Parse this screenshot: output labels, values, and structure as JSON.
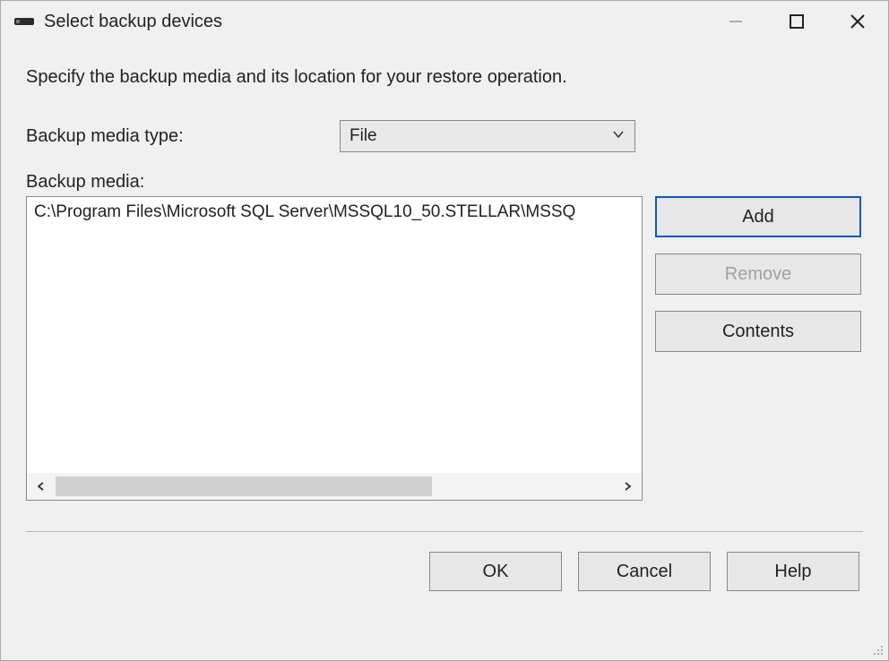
{
  "window": {
    "title": "Select backup devices"
  },
  "instruction": "Specify the backup media and its location for your restore operation.",
  "mediaType": {
    "label": "Backup media type:",
    "selected": "File"
  },
  "mediaList": {
    "label": "Backup media:",
    "items": [
      "C:\\Program Files\\Microsoft SQL Server\\MSSQL10_50.STELLAR\\MSSQ"
    ]
  },
  "sideButtons": {
    "add": "Add",
    "remove": "Remove",
    "contents": "Contents"
  },
  "footer": {
    "ok": "OK",
    "cancel": "Cancel",
    "help": "Help"
  }
}
